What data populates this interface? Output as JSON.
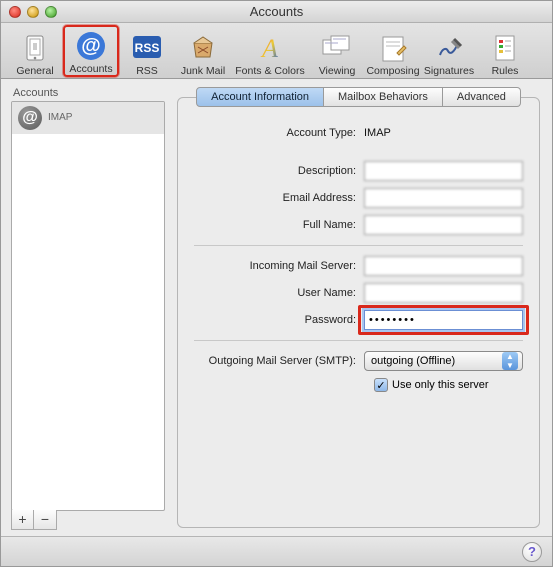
{
  "window": {
    "title": "Accounts"
  },
  "toolbar": {
    "items": [
      {
        "label": "General"
      },
      {
        "label": "Accounts"
      },
      {
        "label": "RSS"
      },
      {
        "label": "Junk Mail"
      },
      {
        "label": "Fonts & Colors"
      },
      {
        "label": "Viewing"
      },
      {
        "label": "Composing"
      },
      {
        "label": "Signatures"
      },
      {
        "label": "Rules"
      }
    ]
  },
  "sidebar": {
    "heading": "Accounts",
    "account": {
      "name": "",
      "type": "IMAP"
    }
  },
  "tabs": {
    "info": "Account Information",
    "mailbox": "Mailbox Behaviors",
    "advanced": "Advanced"
  },
  "form": {
    "account_type_label": "Account Type:",
    "account_type_value": "IMAP",
    "description_label": "Description:",
    "description_value": "",
    "email_label": "Email Address:",
    "email_value": "",
    "fullname_label": "Full Name:",
    "fullname_value": "",
    "incoming_label": "Incoming Mail Server:",
    "incoming_value": "",
    "username_label": "User Name:",
    "username_value": "",
    "password_label": "Password:",
    "password_value": "••••••••",
    "smtp_label": "Outgoing Mail Server (SMTP):",
    "smtp_value": "outgoing (Offline)",
    "use_only_label": "Use only this server"
  },
  "buttons": {
    "add": "+",
    "remove": "−",
    "help": "?"
  }
}
